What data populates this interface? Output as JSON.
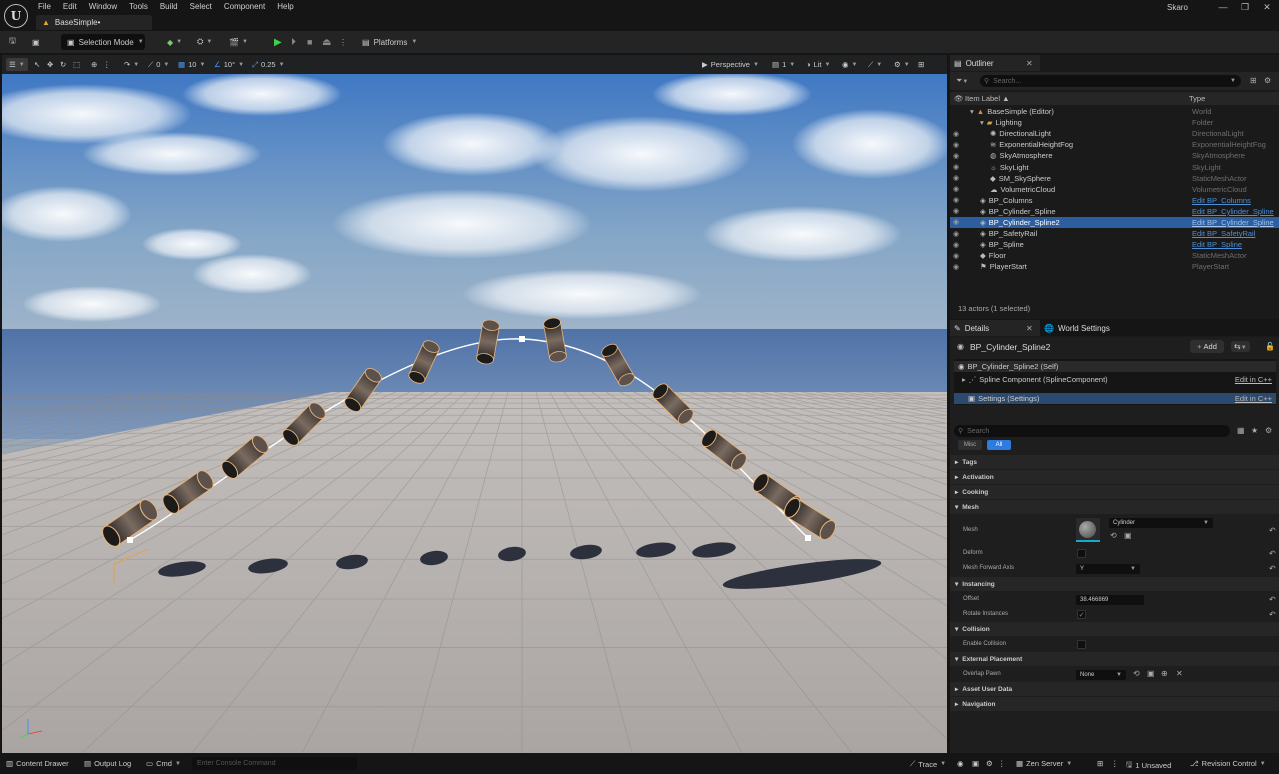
{
  "menu": [
    "File",
    "Edit",
    "Window",
    "Tools",
    "Build",
    "Select",
    "Component",
    "Help"
  ],
  "tab_title": "BaseSimple•",
  "user": "Skaro",
  "toolbar": {
    "selection_mode": "Selection Mode",
    "platforms": "Platforms"
  },
  "viewport_toolbar": {
    "snap_translate": "0",
    "grid_location": "10",
    "grid_rotation": "10°",
    "grid_scale": "0.25",
    "perspective": "Perspective",
    "camera_speed": "1",
    "lit": "Lit"
  },
  "outliner": {
    "tab": "Outliner",
    "search_placeholder": "Search...",
    "col_label": "Item Label ▲",
    "col_type": "Type",
    "rows": [
      {
        "label": "BaseSimple (Editor)",
        "type": "World",
        "indent": 1,
        "icon": "world-icon"
      },
      {
        "label": "Lighting",
        "type": "Folder",
        "indent": 2,
        "icon": "folder-icon"
      },
      {
        "label": "DirectionalLight",
        "type": "DirectionalLight",
        "indent": 3,
        "icon": "light-icon"
      },
      {
        "label": "ExponentialHeightFog",
        "type": "ExponentialHeightFog",
        "indent": 3,
        "icon": "fog-icon"
      },
      {
        "label": "SkyAtmosphere",
        "type": "SkyAtmosphere",
        "indent": 3,
        "icon": "atmosphere-icon"
      },
      {
        "label": "SkyLight",
        "type": "SkyLight",
        "indent": 3,
        "icon": "skylight-icon"
      },
      {
        "label": "SM_SkySphere",
        "type": "StaticMeshActor",
        "indent": 3,
        "icon": "mesh-icon"
      },
      {
        "label": "VolumetricCloud",
        "type": "VolumetricCloud",
        "indent": 3,
        "icon": "cloud-icon"
      },
      {
        "label": "BP_Columns",
        "type": "Edit BP_Columns",
        "indent": 2,
        "icon": "blueprint-icon",
        "link": true
      },
      {
        "label": "BP_Cylinder_Spline",
        "type": "Edit BP_Cylinder_Spline",
        "indent": 2,
        "icon": "blueprint-icon",
        "link": true
      },
      {
        "label": "BP_Cylinder_Spline2",
        "type": "Edit BP_Cylinder_Spline",
        "indent": 2,
        "icon": "blueprint-icon",
        "link": true,
        "selected": true
      },
      {
        "label": "BP_SafetyRail",
        "type": "Edit BP_SafetyRail",
        "indent": 2,
        "icon": "blueprint-icon",
        "link": true
      },
      {
        "label": "BP_Spline",
        "type": "Edit BP_Spline",
        "indent": 2,
        "icon": "blueprint-icon",
        "link": true
      },
      {
        "label": "Floor",
        "type": "StaticMeshActor",
        "indent": 2,
        "icon": "mesh-icon"
      },
      {
        "label": "PlayerStart",
        "type": "PlayerStart",
        "indent": 2,
        "icon": "playerstart-icon"
      }
    ],
    "actor_count": "13 actors (1 selected)"
  },
  "details": {
    "tab": "Details",
    "world_settings_tab": "World Settings",
    "actor_name": "BP_Cylinder_Spline2",
    "add_label": "Add",
    "components": {
      "self": "BP_Cylinder_Spline2 (Self)",
      "spline": "Spline Component (SplineComponent)",
      "settings": "Settings (Settings)",
      "edit_cpp": "Edit in C++"
    },
    "search_placeholder": "Search",
    "filters": {
      "misc": "Misc",
      "all": "All"
    },
    "sections": {
      "tags": "Tags",
      "activation": "Activation",
      "cooking": "Cooking",
      "mesh": "Mesh",
      "instancing": "Instancing",
      "collision": "Collision",
      "external": "External Placement",
      "asset_user_data": "Asset User Data",
      "navigation": "Navigation"
    },
    "props": {
      "mesh_label": "Mesh",
      "mesh_value": "Cylinder",
      "deform_label": "Deform",
      "forward_axis_label": "Mesh Forward Axis",
      "forward_axis_value": "Y",
      "offset_label": "Offset",
      "offset_value": "38.466869",
      "rotate_label": "Rotate Instances",
      "collision_label": "Enable Collision",
      "overlap_label": "Overlap Pawn",
      "overlap_value": "None"
    }
  },
  "statusbar": {
    "content_drawer": "Content Drawer",
    "output_log": "Output Log",
    "cmd": "Cmd",
    "console_placeholder": "Enter Console Command",
    "trace": "Trace",
    "zen": "Zen Server",
    "unsaved": "1 Unsaved",
    "revision": "Revision Control"
  }
}
